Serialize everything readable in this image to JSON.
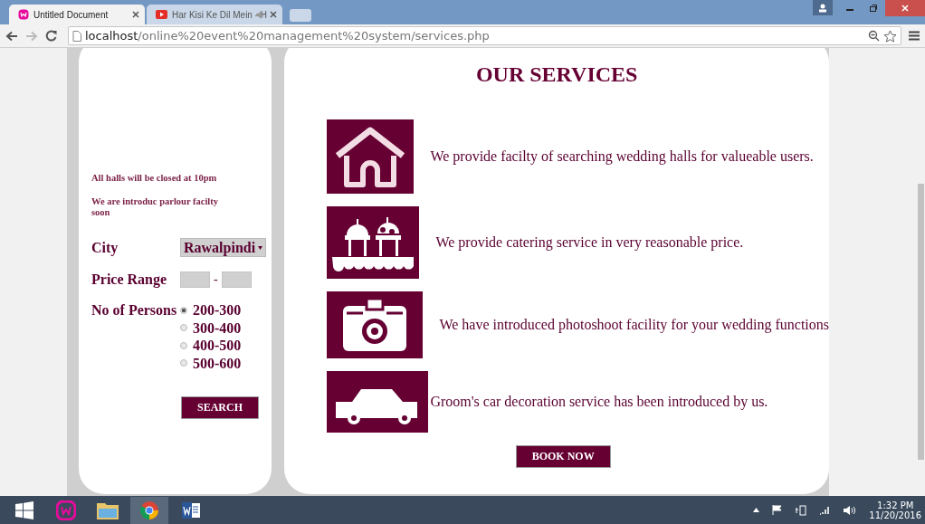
{
  "browser": {
    "tabs": [
      {
        "title": "Untitled Document",
        "selected": true,
        "audio": false
      },
      {
        "title": "Har Kisi Ke Dil Mein - H",
        "selected": false,
        "audio": true
      }
    ],
    "url_host": "localhost",
    "url_path": "/online%20event%20management%20system/services.php"
  },
  "sidebar": {
    "notices": [
      "All halls will be closed at 10pm",
      "We are introduc parlour facilty soon"
    ],
    "city": {
      "label": "City",
      "value": "Rawalpindi"
    },
    "price_range": {
      "label": "Price Range",
      "separator": "-"
    },
    "persons": {
      "label": "No of Persons",
      "options": [
        {
          "label": "200-300",
          "selected": true
        },
        {
          "label": "300-400",
          "selected": false
        },
        {
          "label": "400-500",
          "selected": false
        },
        {
          "label": "500-600",
          "selected": false
        }
      ]
    },
    "search_button": "SEARCH"
  },
  "services": {
    "title": "OUR SERVICES",
    "items": [
      {
        "kind": "house",
        "text": "We provide facilty of searching wedding halls for valueable users."
      },
      {
        "kind": "catering",
        "text": "We provide catering service in very reasonable price."
      },
      {
        "kind": "camera",
        "text": "We have introduced photoshoot facility for your wedding functions"
      },
      {
        "kind": "car",
        "text": "Groom's car decoration service has been introduced by us."
      }
    ],
    "book_button": "BOOK NOW"
  },
  "taskbar": {
    "time": "1:32 PM",
    "date": "11/20/2016"
  }
}
